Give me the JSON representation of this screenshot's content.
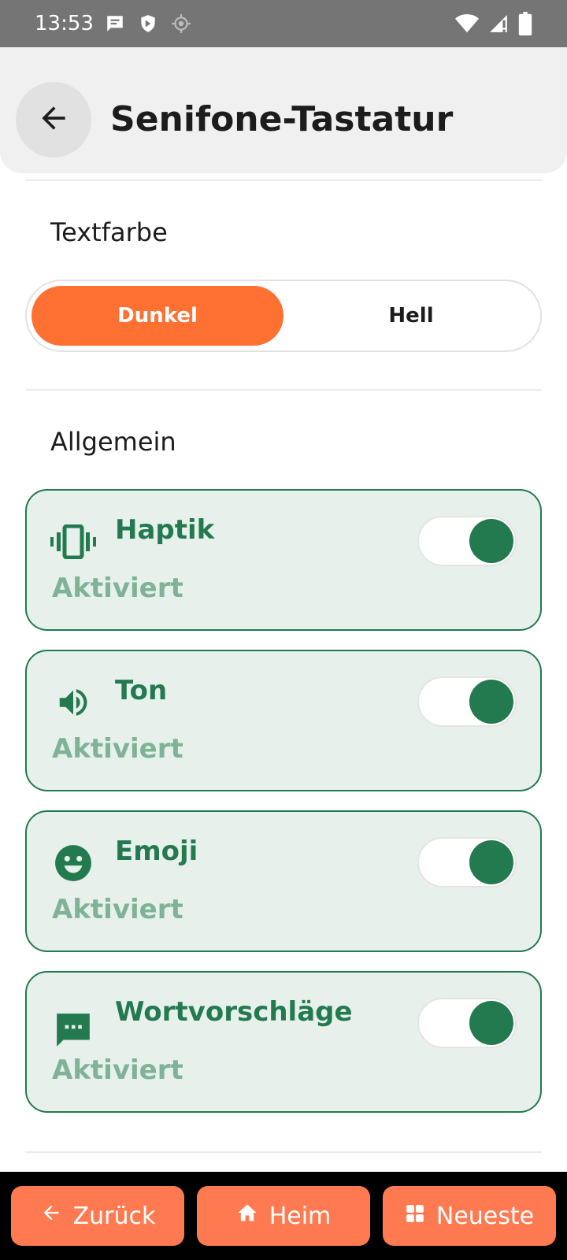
{
  "status_bar": {
    "time": "13:53",
    "left_icons": [
      "message-icon",
      "shield-icon",
      "location-icon"
    ],
    "right_icons": [
      "wifi-icon",
      "signal-icon",
      "battery-icon"
    ]
  },
  "header": {
    "back_icon": "arrow-left-icon",
    "title": "Senifone-Tastatur"
  },
  "text_color_section": {
    "title": "Textfarbe",
    "options": [
      {
        "label": "Dunkel",
        "selected": true
      },
      {
        "label": "Hell",
        "selected": false
      }
    ],
    "accent_color": "#ff7033"
  },
  "general_section": {
    "title": "Allgemein",
    "items": [
      {
        "icon": "vibration-icon",
        "label": "Haptik",
        "status": "Aktiviert",
        "enabled": true
      },
      {
        "icon": "volume-icon",
        "label": "Ton",
        "status": "Aktiviert",
        "enabled": true
      },
      {
        "icon": "emoji-icon",
        "label": "Emoji",
        "status": "Aktiviert",
        "enabled": true
      },
      {
        "icon": "chat-icon",
        "label": "Wortvorschläge",
        "status": "Aktiviert",
        "enabled": true
      }
    ],
    "card_color": "#237a4f"
  },
  "bottom_nav": {
    "back_label": "Zurück",
    "home_label": "Heim",
    "recent_label": "Neueste",
    "button_color": "#ff7a50"
  }
}
